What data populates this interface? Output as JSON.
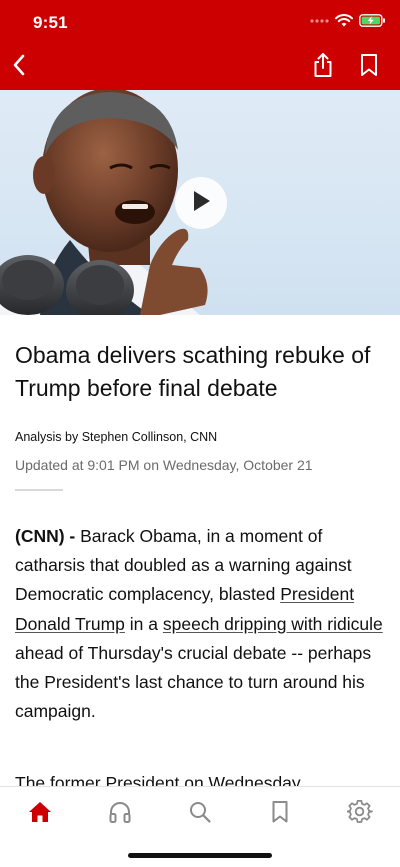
{
  "status_bar": {
    "time": "9:51"
  },
  "toolbar": {
    "back_icon": "chevron-left-icon",
    "share_icon": "share-icon",
    "bookmark_icon": "bookmark-icon"
  },
  "media": {
    "play_icon": "play-icon"
  },
  "article": {
    "headline": "Obama delivers scathing rebuke of Trump before final debate",
    "byline": "Analysis by Stephen Collinson, CNN",
    "updated": "Updated at 9:01 PM on Wednesday, October 21",
    "lede_source": "(CNN) -",
    "p1_a": " Barack Obama, in a moment of catharsis that doubled as a warning against Democratic complacency, blasted ",
    "link_1": "President Donald Trump",
    "p1_b": " in a ",
    "link_2": "speech dripping with ridicule",
    "p1_c": " ahead of Thursday's crucial debate -- perhaps the President's last chance to turn around his campaign.",
    "p2": "The former President on Wednesday"
  },
  "tab_bar": {
    "items": [
      {
        "name": "home",
        "icon": "home-icon",
        "active": true
      },
      {
        "name": "listen",
        "icon": "headphones-icon",
        "active": false
      },
      {
        "name": "search",
        "icon": "search-icon",
        "active": false
      },
      {
        "name": "saved",
        "icon": "bookmark-icon",
        "active": false
      },
      {
        "name": "settings",
        "icon": "gear-icon",
        "active": false
      }
    ]
  },
  "colors": {
    "brand": "#cc0000",
    "inactive_tab": "#8a8a8a",
    "meta_text": "#6b6b6b"
  }
}
